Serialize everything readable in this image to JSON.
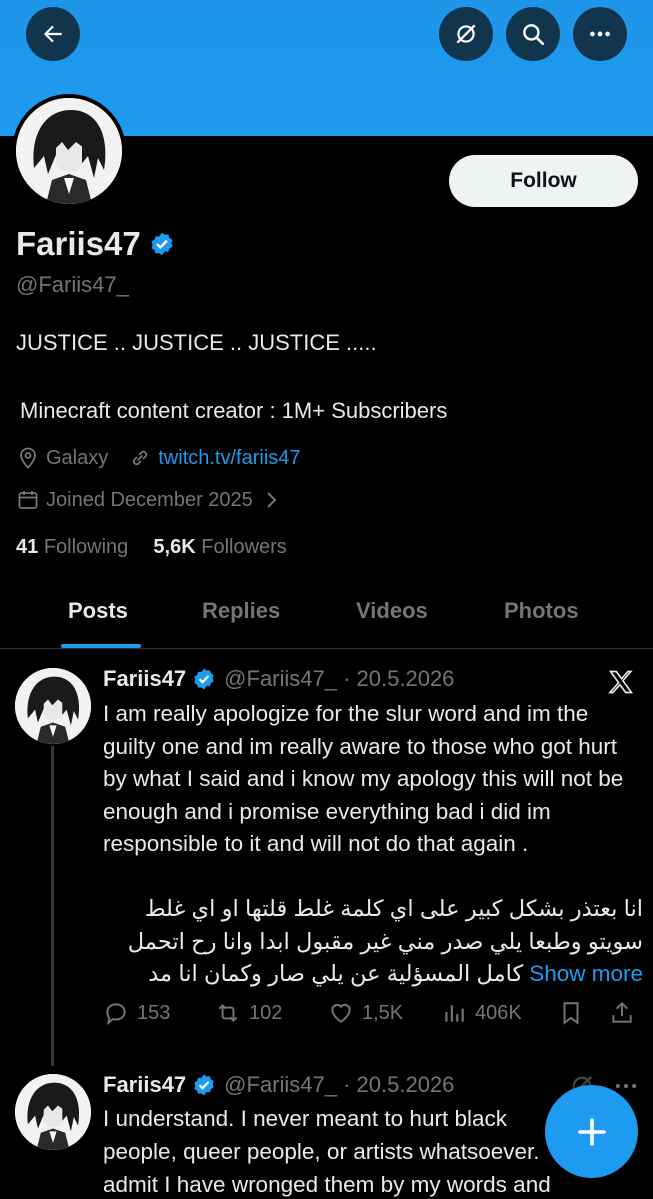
{
  "header": {
    "back_icon": "arrow-left-icon",
    "grok_icon": "grok-icon",
    "search_icon": "search-icon",
    "more_icon": "more-horizontal-icon",
    "banner_color": "#1d9bf0"
  },
  "profile": {
    "display_name": "Fariis47",
    "handle": "@Fariis47_",
    "follow_label": "Follow",
    "bio_line1": "JUSTICE .. JUSTICE .. JUSTICE .....",
    "bio_line2": "Minecraft content creator : 1M+ Subscribers",
    "location": "Galaxy",
    "website": "twitch.tv/fariis47",
    "joined": "Joined December 2025",
    "following_count": "41",
    "following_label": "Following",
    "followers_count": "5,6K",
    "followers_label": "Followers"
  },
  "tabs": [
    {
      "label": "Posts",
      "active": true
    },
    {
      "label": "Replies",
      "active": false
    },
    {
      "label": "Videos",
      "active": false
    },
    {
      "label": "Photos",
      "active": false
    }
  ],
  "posts": [
    {
      "name": "Fariis47",
      "handle_date": "@Fariis47_ · 20.5.2026",
      "text_en": "I am really apologize for the slur word and im the guilty one and im really aware to those who got hurt by what I said and i know my apology this will not be enough and i promise everything bad i did im responsible to it and will not do that again .",
      "text_ar_1": "انا بعتذر بشكل كبير على اي كلمة غلط قلتها او اي غلط",
      "text_ar_2": "سويتو وطبعا يلي صدر مني غير مقبول ابدا وانا رح اتحمل",
      "text_ar_3": "كامل المسؤلية عن يلي صار وكمان انا مد",
      "show_more": "Show more",
      "replies": "153",
      "reposts": "102",
      "likes": "1,5K",
      "views": "406K"
    },
    {
      "name": "Fariis47",
      "handle_date": "@Fariis47_ · 20.5.2026",
      "line1": "I understand. I never meant to hurt black",
      "line2": "people, queer people, or artists whatsoever.",
      "line3": "admit I have wronged them by my words and"
    }
  ],
  "fab": {
    "icon": "plus-icon"
  }
}
